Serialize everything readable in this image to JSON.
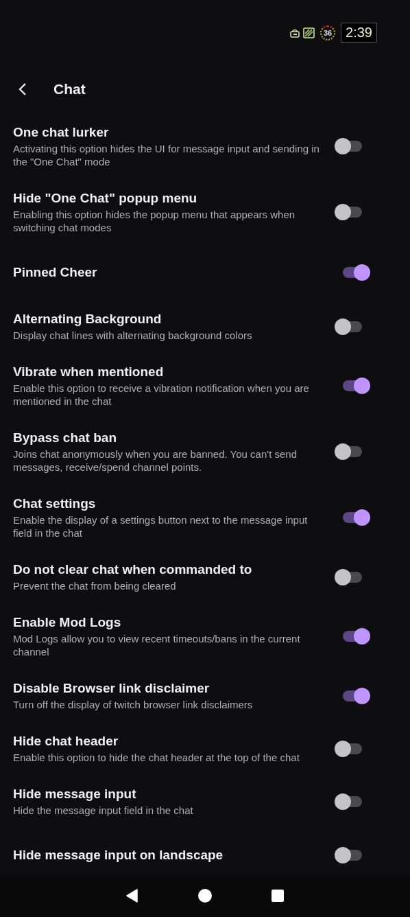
{
  "status_bar": {
    "battery_percent": "36",
    "time": "2:39"
  },
  "header": {
    "title": "Chat"
  },
  "settings": [
    {
      "title": "One chat lurker",
      "description": "Activating this option hides the UI for message input and sending in the \"One Chat\" mode",
      "on": false
    },
    {
      "title": "Hide \"One Chat\" popup menu",
      "description": "Enabling this option hides the popup menu that appears when switching chat modes",
      "on": false
    },
    {
      "title": "Pinned Cheer",
      "on": true
    },
    {
      "title": "Alternating Background",
      "description": "Display chat lines with alternating background colors",
      "on": false
    },
    {
      "title": "Vibrate when mentioned",
      "description": "Enable this option to receive a vibration notification when you are mentioned in the chat",
      "on": true
    },
    {
      "title": "Bypass chat ban",
      "description": "Joins chat anonymously when you are banned. You can't send messages, receive/spend channel points.",
      "on": false
    },
    {
      "title": "Chat settings",
      "description": "Enable the display of a settings button next to the message input field in the chat",
      "on": true
    },
    {
      "title": "Do not clear chat when commanded to",
      "description": "Prevent the chat from being cleared",
      "on": false
    },
    {
      "title": "Enable Mod Logs",
      "description": "Mod Logs allow you to view recent timeouts/bans in the current channel",
      "on": true
    },
    {
      "title": "Disable Browser link disclaimer",
      "description": "Turn off the display of twitch browser link disclaimers",
      "on": true
    },
    {
      "title": "Hide chat header",
      "description": "Enable this option to hide the chat header at the top of the chat",
      "on": false
    },
    {
      "title": "Hide message input",
      "description": "Hide the message input field in the chat",
      "on": false
    },
    {
      "title": "Hide message input on landscape",
      "on": false
    }
  ]
}
